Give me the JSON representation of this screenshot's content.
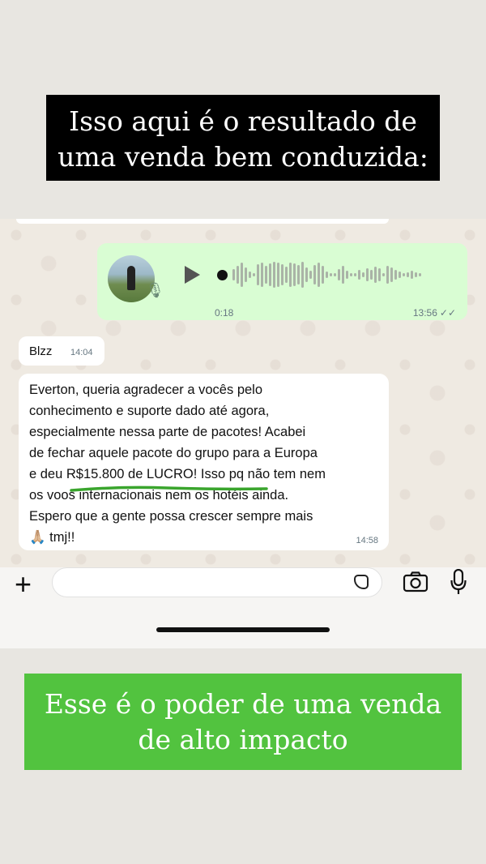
{
  "top_caption": "Isso aqui é o resultado de uma venda bem conduzida:",
  "chat": {
    "audio_message": {
      "duration": "0:18",
      "time": "13:56",
      "status": "✓✓",
      "played": true
    },
    "sender_name": "Blzz",
    "sender_time": "14:04",
    "message": {
      "text": "Everton, queria agradecer a vocês pelo\nconhecimento e suporte dado até agora,\nespecialmente nessa parte de pacotes! Acabei\nde fechar aquele pacote do grupo para a Europa\ne deu R$15.800 de LUCRO! Isso pq não tem nem\nos voos internacionais nem os hotéis ainda.\nEspero que a gente possa crescer sempre mais\n🙏🏼 tmj!!",
      "time": "14:58",
      "highlight_color": "#3aa52d"
    }
  },
  "composer": {
    "placeholder": ""
  },
  "bottom_caption": "Esse é o poder de uma venda de alto impacto",
  "colors": {
    "top_caption_bg": "#000000",
    "bottom_caption_bg": "#52c33f",
    "outgoing_bubble": "#d9fdd3",
    "incoming_bubble": "#ffffff"
  }
}
